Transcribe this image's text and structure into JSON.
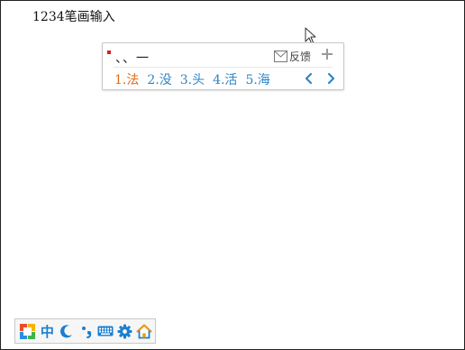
{
  "document": {
    "text": "1234笔画输入"
  },
  "candidate_window": {
    "composition": "、、一",
    "feedback_label": "反馈",
    "feedback_icon": "mail-icon",
    "expand_icon": "plus-icon",
    "candidates": [
      {
        "text": "1.法",
        "active": true
      },
      {
        "text": "2.没",
        "active": false
      },
      {
        "text": "3.头",
        "active": false
      },
      {
        "text": "4.活",
        "active": false
      },
      {
        "text": "5.海",
        "active": false
      }
    ],
    "prev_icon": "chevron-left-icon",
    "next_icon": "chevron-right-icon",
    "colors": {
      "active": "#e06a1a",
      "candidate": "#2e86c6",
      "indicator": "#d62020"
    }
  },
  "status_bar": {
    "language_label": "中",
    "items": [
      "sogou-logo-icon",
      "language-toggle",
      "half-width-moon-icon",
      "punctuation-icon",
      "keyboard-icon",
      "settings-gear-icon",
      "home-icon"
    ],
    "accent": "#1a7fd0"
  }
}
